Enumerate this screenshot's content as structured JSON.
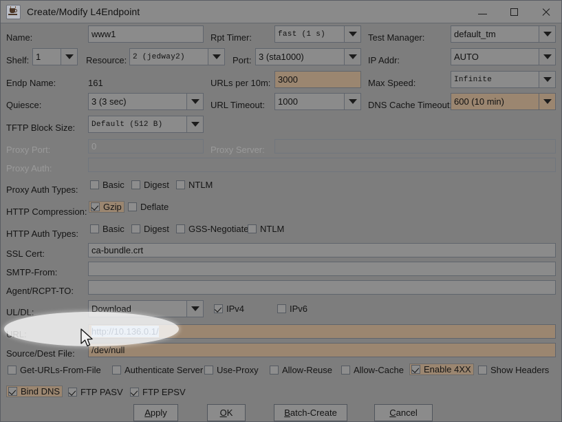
{
  "window": {
    "title": "Create/Modify L4Endpoint",
    "icon": "java-cup-icon",
    "controls": {
      "minimize": "–",
      "maximize": "□",
      "close": "✕"
    }
  },
  "fields": {
    "name": {
      "label": "Name:",
      "value": "www1"
    },
    "rpt_timer": {
      "label": "Rpt Timer:",
      "value": "fast    (1 s)"
    },
    "test_manager": {
      "label": "Test Manager:",
      "value": "default_tm"
    },
    "shelf": {
      "label": "Shelf:",
      "value": "1"
    },
    "resource": {
      "label": "Resource:",
      "value": "2  (jedway2)"
    },
    "port": {
      "label": "Port:",
      "value": "3 (sta1000)"
    },
    "ip_addr": {
      "label": "IP Addr:",
      "value": "AUTO"
    },
    "endp_name": {
      "label": "Endp Name:",
      "value": "161"
    },
    "urls_per_10m": {
      "label": "URLs per 10m:",
      "value": "3000"
    },
    "max_speed": {
      "label": "Max Speed:",
      "value": "Infinite"
    },
    "quiesce": {
      "label": "Quiesce:",
      "value": "3 (3 sec)"
    },
    "url_timeout": {
      "label": "URL Timeout:",
      "value": "1000"
    },
    "dns_cache_timeout": {
      "label": "DNS Cache Timeout:",
      "value": "600 (10 min)"
    },
    "tftp_block_size": {
      "label": "TFTP Block Size:",
      "value": "Default  (512 B)"
    },
    "proxy_port": {
      "label": "Proxy Port:",
      "value": "0"
    },
    "proxy_server": {
      "label": "Proxy Server:",
      "value": ""
    },
    "proxy_auth": {
      "label": "Proxy Auth:",
      "value": ""
    },
    "proxy_auth_types": {
      "label": "Proxy Auth Types:"
    },
    "http_compression": {
      "label": "HTTP Compression:"
    },
    "http_auth_types": {
      "label": "HTTP Auth Types:"
    },
    "ssl_cert": {
      "label": "SSL Cert:",
      "value": "ca-bundle.crt"
    },
    "smtp_from": {
      "label": "SMTP-From:",
      "value": ""
    },
    "agent_rcpt_to": {
      "label": "Agent/RCPT-TO:",
      "value": ""
    },
    "ul_dl": {
      "label": "UL/DL:",
      "value": "Download"
    },
    "url": {
      "label": "URL:",
      "value": "http://10.136.0.1/"
    },
    "source_dest_file": {
      "label": "Source/Dest File:",
      "value": "/dev/null"
    }
  },
  "checkboxes": {
    "proxy_auth_types": [
      {
        "label": "Basic",
        "checked": false
      },
      {
        "label": "Digest",
        "checked": false
      },
      {
        "label": "NTLM",
        "checked": false
      }
    ],
    "http_compression": [
      {
        "label": "Gzip",
        "checked": true,
        "highlight": true
      },
      {
        "label": "Deflate",
        "checked": false
      }
    ],
    "http_auth_types": [
      {
        "label": "Basic",
        "checked": false
      },
      {
        "label": "Digest",
        "checked": false
      },
      {
        "label": "GSS-Negotiate",
        "checked": false
      },
      {
        "label": "NTLM",
        "checked": false
      }
    ],
    "ip_version": [
      {
        "label": "IPv4",
        "checked": true
      },
      {
        "label": "IPv6",
        "checked": false
      }
    ],
    "options_row1": [
      {
        "label": "Get-URLs-From-File",
        "checked": false
      },
      {
        "label": "Authenticate Server",
        "checked": false
      },
      {
        "label": "Use-Proxy",
        "checked": false
      },
      {
        "label": "Allow-Reuse",
        "checked": false
      },
      {
        "label": "Allow-Cache",
        "checked": false
      },
      {
        "label": "Enable 4XX",
        "checked": true,
        "highlight": true
      },
      {
        "label": "Show Headers",
        "checked": false
      }
    ],
    "options_row2": [
      {
        "label": "Bind DNS",
        "checked": true,
        "highlight": true
      },
      {
        "label": "FTP PASV",
        "checked": true
      },
      {
        "label": "FTP EPSV",
        "checked": true
      }
    ]
  },
  "buttons": {
    "apply": {
      "mnemonic": "A",
      "rest": "pply"
    },
    "ok": {
      "mnemonic": "O",
      "rest": "K"
    },
    "batch_create": {
      "mnemonic": "B",
      "rest": "atch-Create"
    },
    "cancel": {
      "mnemonic": "C",
      "rest": "ancel"
    }
  },
  "colors": {
    "background": "#7d7d7d",
    "titlebar": "#8a8a8a",
    "field": "#8b8b8b",
    "highlight": "#9b8670",
    "selection": "#aec4de",
    "border": "#5f646c"
  }
}
